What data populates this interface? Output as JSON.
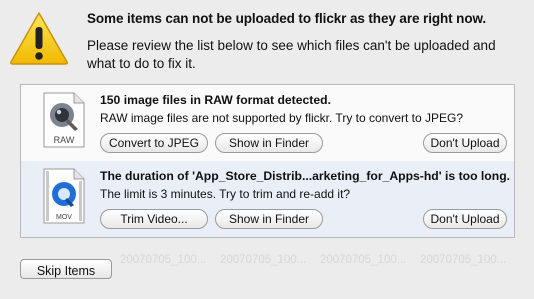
{
  "dialog": {
    "title": "Some items can not be uploaded to flickr as they are right now.",
    "subtitle": "Please review the list below to see which files can't be uploaded and what to do to fix it."
  },
  "items": [
    {
      "icon": "raw-file-icon",
      "icon_label": "RAW",
      "title": "150 image files in RAW format detected.",
      "description": "RAW image files are not supported by flickr. Try to convert to JPEG?",
      "primary_button": "Convert to JPEG",
      "finder_button": "Show in Finder",
      "dont_upload_button": "Don't Upload"
    },
    {
      "icon": "quicktime-movie-icon",
      "icon_label": "MOV",
      "title": "The duration of 'App_Store_Distrib...arketing_for_Apps-hd' is too long.",
      "description": "The limit is 3 minutes. Try to trim and re-add it?",
      "primary_button": "Trim Video...",
      "finder_button": "Show in Finder",
      "dont_upload_button": "Don't Upload"
    }
  ],
  "background_thumbnails": [
    "20070705_100...",
    "20070705_100...",
    "20070705_100...",
    "20070705_100..."
  ],
  "footer": {
    "skip_button": "Skip Items"
  },
  "colors": {
    "warning_yellow": "#f5c400",
    "alt_row": "#e9eef7",
    "background": "#ececec"
  }
}
